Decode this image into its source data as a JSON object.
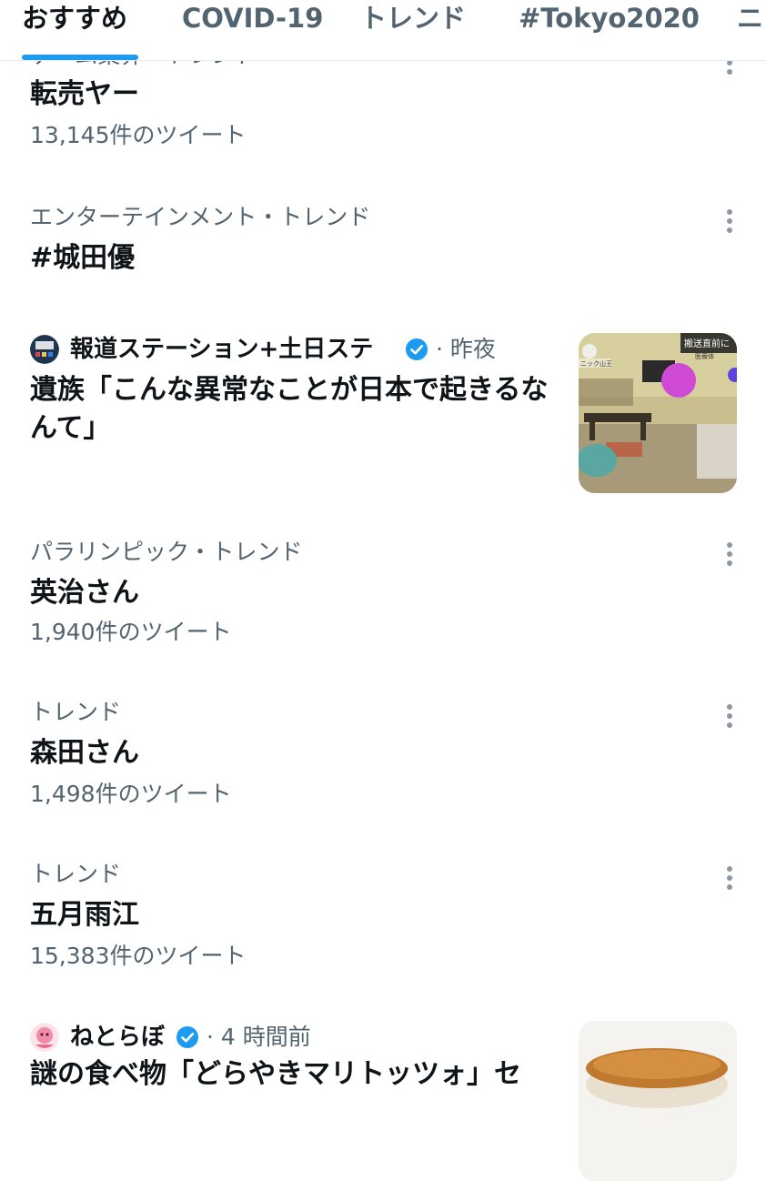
{
  "tabs": [
    {
      "label": "おすすめ"
    },
    {
      "label": "COVID-19"
    },
    {
      "label": "トレンド"
    },
    {
      "label": "#Tokyo2020"
    },
    {
      "label": "ニ"
    }
  ],
  "trends": [
    {
      "context": "ゲーム業界・トレンド",
      "title": "転売ヤー",
      "count": "13,145件のツイート"
    },
    {
      "context": "エンターテインメント・トレンド",
      "title": "#城田優",
      "count": ""
    },
    {
      "context": "パラリンピック・トレンド",
      "title": "英治さん",
      "count": "1,940件のツイート"
    },
    {
      "context": "トレンド",
      "title": "森田さん",
      "count": "1,498件のツイート"
    },
    {
      "context": "トレンド",
      "title": "五月雨江",
      "count": "15,383件のツイート"
    }
  ],
  "news": [
    {
      "source": "報道ステーション+土日ステ",
      "time": "· 昨夜",
      "title": "遺族「こんな異常なことが日本で起きるなんて」",
      "thumb_caption": "搬送直前に"
    },
    {
      "source": "ねとらぼ",
      "time": "· 4 時間前",
      "title": "謎の食べ物「どらやきマリトッツォ」セ"
    }
  ],
  "icons": {
    "more": "more-vertical-icon",
    "verified": "verified-badge-icon"
  },
  "colors": {
    "accent": "#1d9bf0",
    "secondary_text": "#536471",
    "primary_text": "#0f1419"
  }
}
